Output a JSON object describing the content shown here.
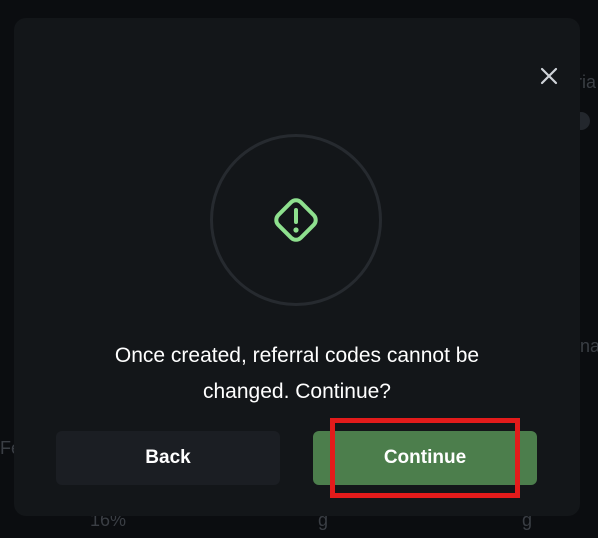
{
  "background": {
    "fragments": [
      "ria",
      "na",
      "Fe",
      "16%",
      "g",
      "g"
    ]
  },
  "modal": {
    "message_line1": "Once created, referral codes cannot be",
    "message_line2": "changed. Continue?",
    "icon": "warning-diamond-icon",
    "close_icon": "close-icon",
    "buttons": {
      "back_label": "Back",
      "continue_label": "Continue"
    }
  },
  "colors": {
    "accent_green": "#8ee08e",
    "continue_bg": "#4c7e4c",
    "back_bg": "#1b1e23",
    "modal_bg": "#131619",
    "highlight": "#e31b1b"
  }
}
